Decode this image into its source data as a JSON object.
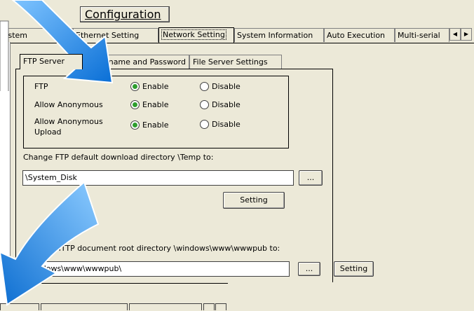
{
  "window": {
    "title": "Configuration"
  },
  "tabs": {
    "items": [
      {
        "label": "System"
      },
      {
        "label": "Ethernet Setting"
      },
      {
        "label": "Network Setting"
      },
      {
        "label": "System Information"
      },
      {
        "label": "Auto Execution"
      },
      {
        "label": "Multi-serial"
      }
    ],
    "active": "Network Setting"
  },
  "subtabs": {
    "items": [
      {
        "label": "FTP Server"
      },
      {
        "label": "Username and Password"
      },
      {
        "label": "File Server Settings"
      }
    ],
    "active": "FTP Server"
  },
  "ftp": {
    "rows": [
      {
        "label": "FTP",
        "enable": "Enable",
        "disable": "Disable",
        "value": "enable"
      },
      {
        "label": "Allow Anonymous",
        "enable": "Enable",
        "disable": "Disable",
        "value": "enable"
      },
      {
        "label": "Allow Anonymous\nUpload",
        "enable": "Enable",
        "disable": "Disable",
        "value": "enable"
      }
    ],
    "dir_label": "Change FTP default download directory \\Temp to:",
    "dir_value": "\\System_Disk",
    "browse_label": "...",
    "setting_label": "Setting"
  },
  "http": {
    "dir_label": "Change HTTP document root directory \\windows\\www\\wwwpub to:",
    "dir_value": "\\windows\\www\\wwwpub\\",
    "browse_label": "...",
    "setting_label": "Setting"
  },
  "colors": {
    "radio_on": "#2e9e2e",
    "arrow": "#1e88e5",
    "background": "#ece9d8"
  }
}
